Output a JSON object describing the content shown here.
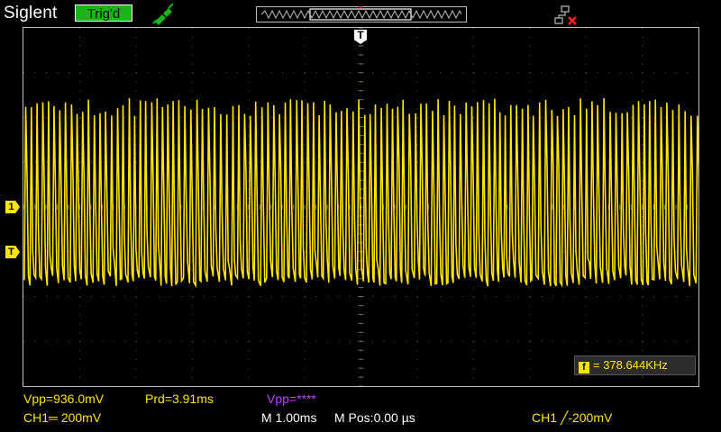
{
  "header": {
    "brand": "Siglent",
    "trigger_status": "Trig'd",
    "icons": [
      "probe-icon",
      "network-disconnected-icon"
    ]
  },
  "channel": {
    "ch1_marker": "1",
    "trigger_level_marker": "T",
    "trigger_position_marker": "T",
    "color": "#ffe400"
  },
  "measure": {
    "freq_label": "f",
    "freq_value": "= 378.644KHz"
  },
  "footer": {
    "vpp": "Vpp=936.0mV",
    "prd": "Prd=3.91ms",
    "vpp2": "Vpp=****",
    "ch1_scale": "CH1═ 200mV",
    "timebase": "M 1.00ms",
    "mpos": "M Pos:0.00 µs",
    "trigger_info": "CH1 ╱-200mV"
  }
}
